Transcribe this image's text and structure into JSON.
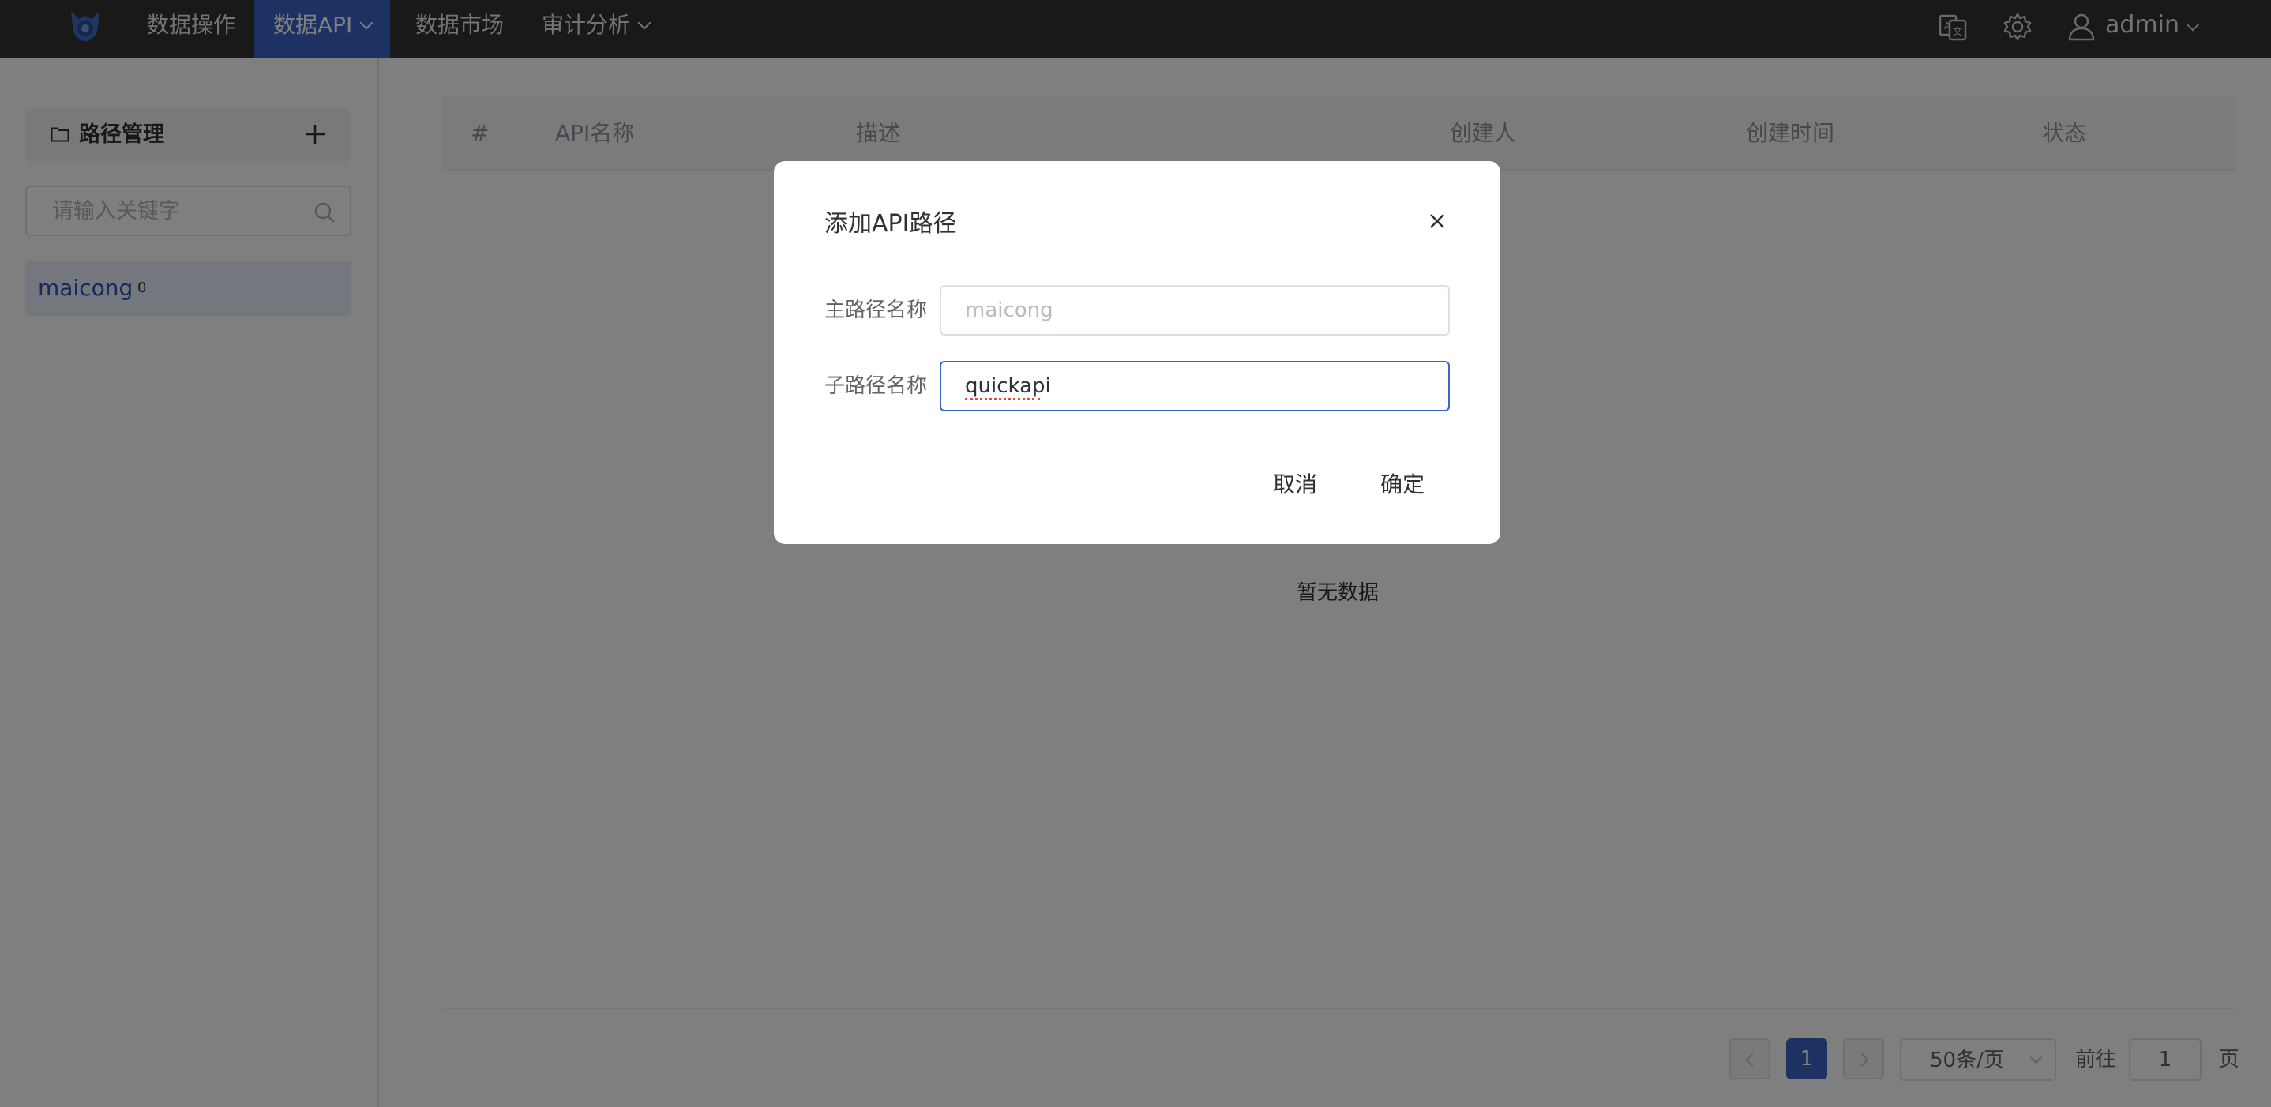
{
  "nav": {
    "items": [
      {
        "label": "数据操作",
        "active": false,
        "has_dropdown": false
      },
      {
        "label": "数据API",
        "active": true,
        "has_dropdown": true
      },
      {
        "label": "数据市场",
        "active": false,
        "has_dropdown": false
      },
      {
        "label": "审计分析",
        "active": false,
        "has_dropdown": true
      }
    ],
    "icons": [
      "translate-icon",
      "settings-icon",
      "user-icon"
    ],
    "user": "admin"
  },
  "sidebar": {
    "title": "路径管理",
    "search_placeholder": "请输入关键字",
    "items": [
      {
        "label": "maicong",
        "count": "0"
      }
    ]
  },
  "table": {
    "columns": [
      "#",
      "API名称",
      "描述",
      "创建人",
      "创建时间",
      "状态"
    ],
    "empty_text": "暂无数据"
  },
  "pagination": {
    "current_page": "1",
    "page_size": "50条/页",
    "goto_label": "前往",
    "goto_value": "1",
    "page_suffix": "页"
  },
  "dialog": {
    "title": "添加API路径",
    "main_path_label": "主路径名称",
    "main_path_placeholder": "maicong",
    "sub_path_label": "子路径名称",
    "sub_path_value": "quickapi",
    "cancel_label": "取消",
    "confirm_label": "确定"
  },
  "colors": {
    "topbar": "#333333",
    "accent": "#3b64c7",
    "overlay": "rgba(0,0,0,0.5)"
  }
}
